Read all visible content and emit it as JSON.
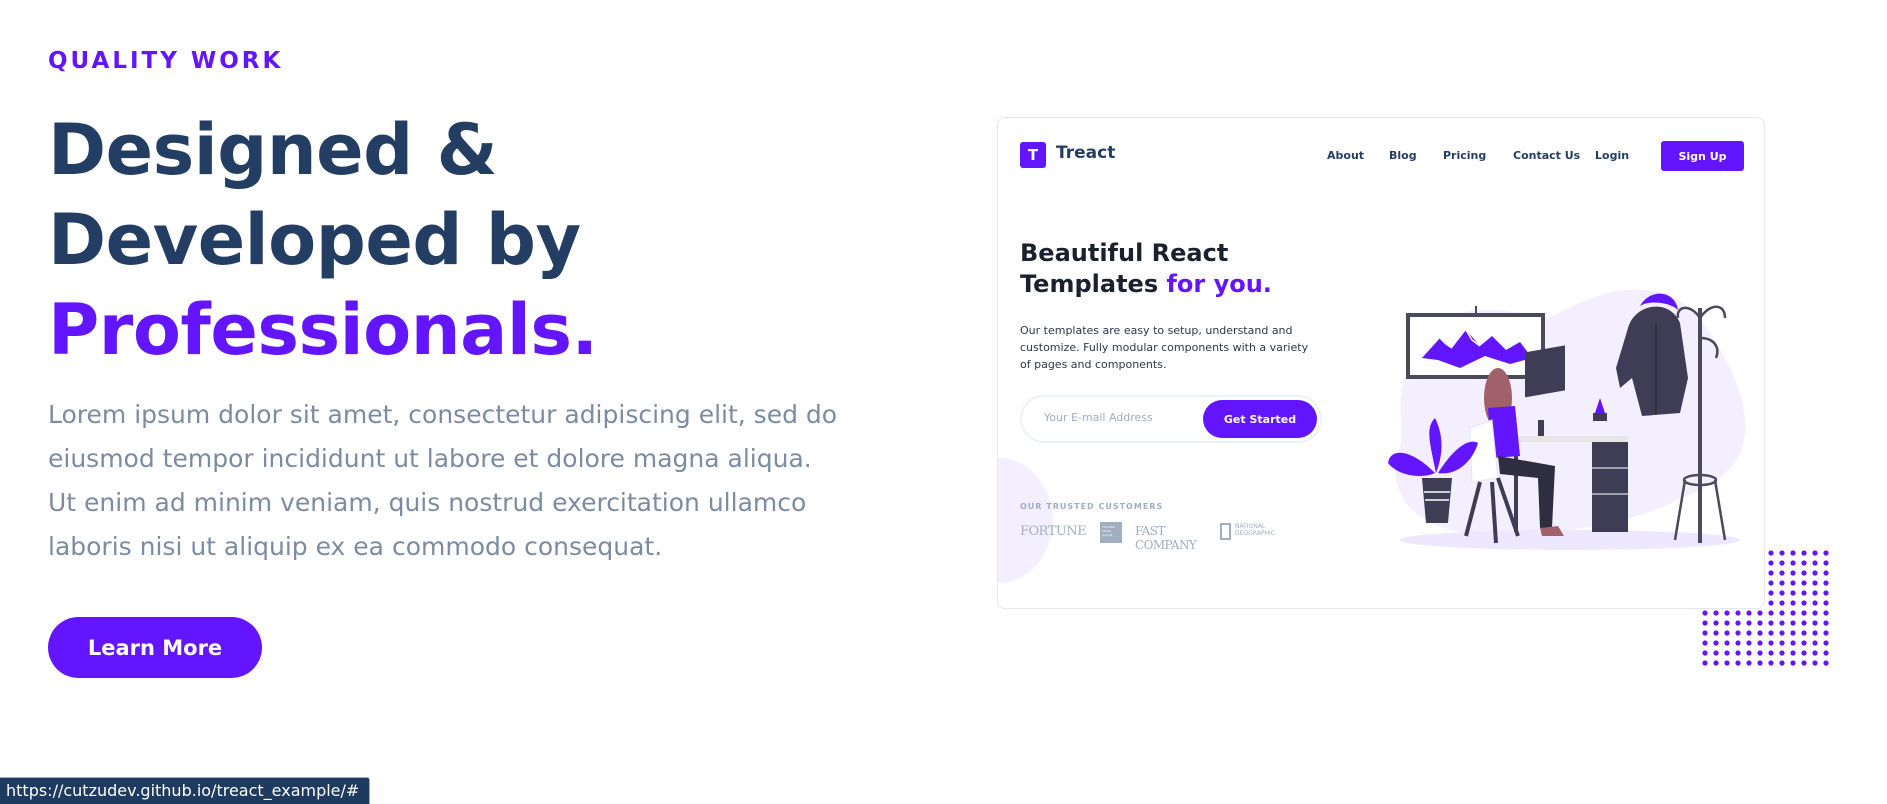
{
  "hero": {
    "subheading": "QUALITY WORK",
    "heading_line1": "Designed &",
    "heading_line2": "Developed by",
    "heading_accent": "Professionals",
    "heading_period": ".",
    "description": "Lorem ipsum dolor sit amet, consectetur adipiscing elit, sed do eiusmod tempor incididunt ut labore et dolore magna aliqua. Ut enim ad minim veniam, quis nostrud exercitation ullamco laboris nisi ut aliquip ex ea commodo consequat.",
    "button_label": "Learn More"
  },
  "preview": {
    "logo_letter": "T",
    "logo_text": "Treact",
    "nav_links": [
      "About",
      "Blog",
      "Pricing",
      "Contact Us"
    ],
    "login_label": "Login",
    "signup_label": "Sign Up",
    "title_line1": "Beautiful React",
    "title_line2": "Templates",
    "title_accent": "for you.",
    "description": "Our templates are easy to setup, understand and customize. Fully modular components with a variety of pages and components.",
    "email_placeholder": "Your E-mail Address",
    "cta_label": "Get Started",
    "customers_label": "OUR TRUSTED CUSTOMERS",
    "customer_logos": {
      "fortune": "FORTUNE",
      "wsj": "The Wall Street Journal",
      "fastcompany": "FAST COMPANY",
      "natgeo_line1": "NATIONAL",
      "natgeo_line2": "GEOGRAPHIC"
    }
  },
  "status_bar": {
    "url": "https://cutzudev.github.io/treact_example/#"
  },
  "colors": {
    "primary": "#6415ff",
    "heading": "#243e63",
    "body_text": "#7c8ba1"
  }
}
